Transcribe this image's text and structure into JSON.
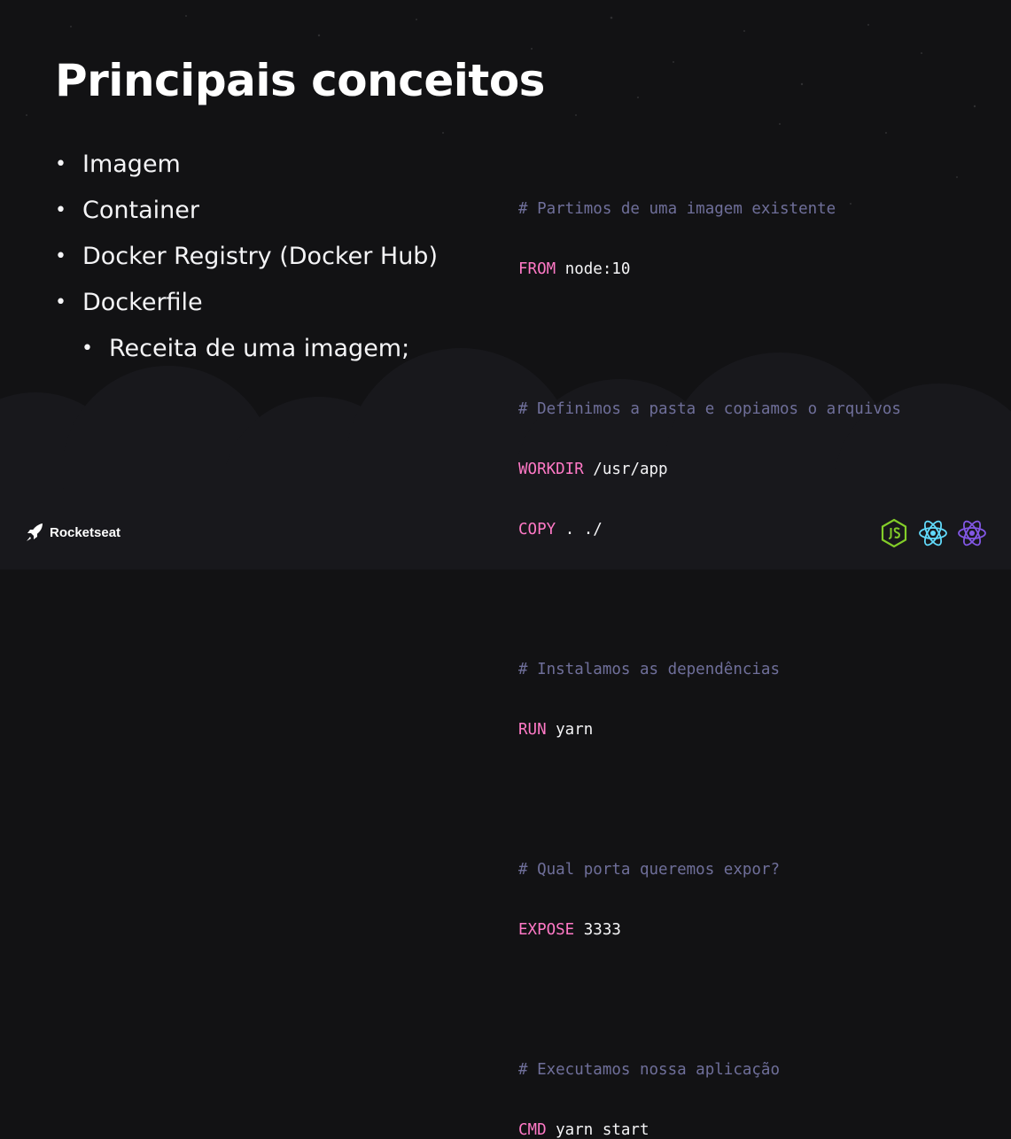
{
  "slide": {
    "title": "Principais conceitos",
    "bullets": [
      {
        "text": "Imagem",
        "level": 1
      },
      {
        "text": "Container",
        "level": 1
      },
      {
        "text": "Docker Registry (Docker Hub)",
        "level": 1
      },
      {
        "text": "Dockerfile",
        "level": 1
      },
      {
        "text": "Receita de uma imagem;",
        "level": 2
      }
    ]
  },
  "code": {
    "blocks": [
      {
        "comment": "# Partimos de uma imagem existente",
        "lines": [
          {
            "keyword": "FROM",
            "arg": " node:10"
          }
        ]
      },
      {
        "comment": "# Definimos a pasta e copiamos o arquivos",
        "lines": [
          {
            "keyword": "WORKDIR",
            "arg": " /usr/app"
          },
          {
            "keyword": "COPY",
            "arg": " . ./"
          }
        ]
      },
      {
        "comment": "# Instalamos as dependências",
        "lines": [
          {
            "keyword": "RUN",
            "arg": " yarn"
          }
        ]
      },
      {
        "comment": "# Qual porta queremos expor?",
        "lines": [
          {
            "keyword": "EXPOSE",
            "arg": " 3333"
          }
        ]
      },
      {
        "comment": "# Executamos nossa aplicação",
        "lines": [
          {
            "keyword": "CMD",
            "arg": " yarn start"
          }
        ]
      }
    ]
  },
  "footer": {
    "brand": "Rocketseat",
    "brand_icon": "rocket-icon",
    "tech_icons": [
      "nodejs-icon",
      "react-icon",
      "react-native-icon"
    ]
  },
  "colors": {
    "background": "#121214",
    "comment": "#6f6f9a",
    "keyword": "#ff79c6",
    "text": "#f4f4f6",
    "node_green": "#83cd29",
    "react_cyan": "#61dafb",
    "react_native_purple": "#8257e5"
  }
}
